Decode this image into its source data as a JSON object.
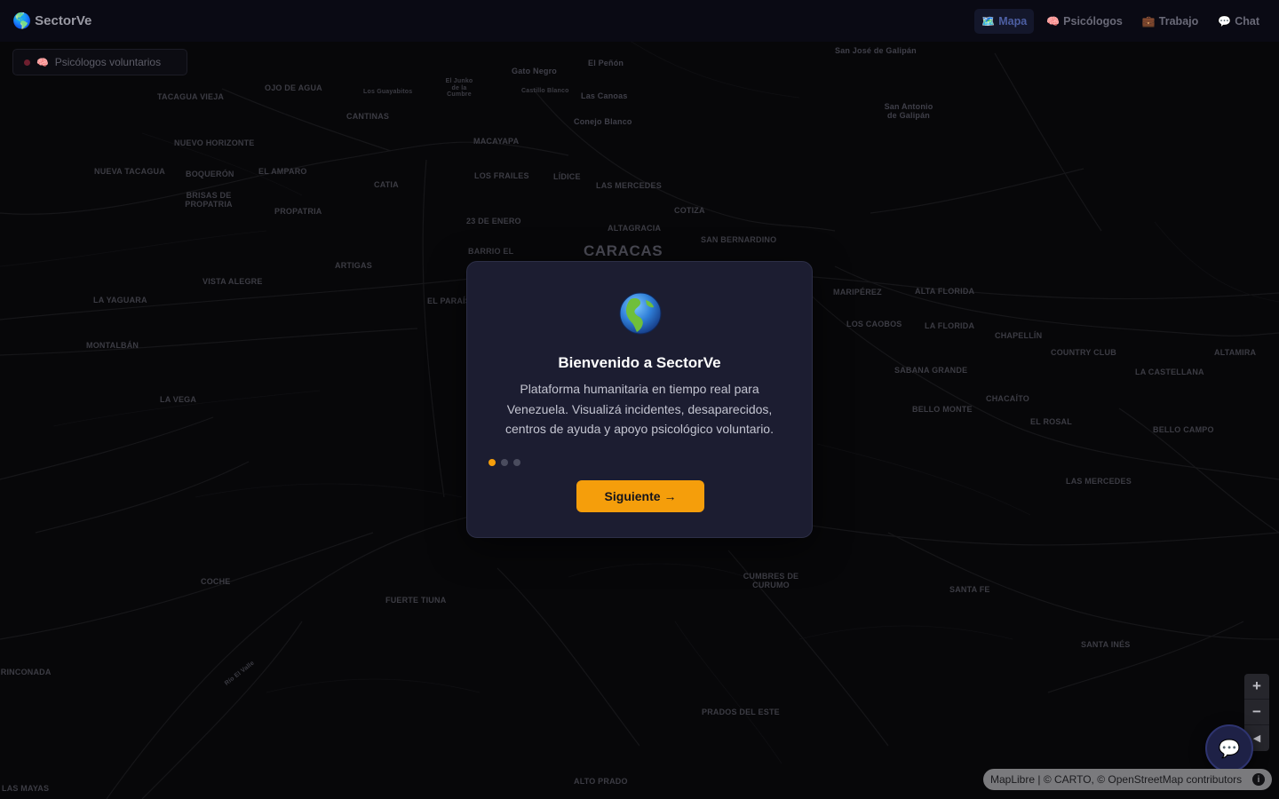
{
  "app": {
    "name": "SectorVe",
    "logo_icon": "🌎"
  },
  "nav": {
    "items": [
      {
        "icon": "🗺️",
        "icon_name": "map-icon",
        "label": "Mapa",
        "active": true
      },
      {
        "icon": "🧠",
        "icon_name": "brain-icon",
        "label": "Psicólogos",
        "active": false
      },
      {
        "icon": "💼",
        "icon_name": "briefcase-icon",
        "label": "Trabajo",
        "active": false
      },
      {
        "icon": "💬",
        "icon_name": "chat-icon",
        "label": "Chat",
        "active": false
      }
    ]
  },
  "legend": {
    "icon": "🧠",
    "label": "Psicólogos voluntarios",
    "dot_color": "#6e1f2f"
  },
  "modal": {
    "icon": "🌎",
    "title": "Bienvenido a SectorVe",
    "description": "Plataforma humanitaria en tiempo real para Venezuela. Visualizá incidentes, desaparecidos, centros de ayuda y apoyo psicológico voluntario.",
    "steps_total": 3,
    "step_current": 1,
    "next_label": "Siguiente →",
    "accent_color": "#f59e0b"
  },
  "map": {
    "city_label": "CARACAS",
    "places": [
      {
        "name": "San José de Galipán",
        "style": "mixed"
      },
      {
        "name": "El Peñón",
        "style": "mixed"
      },
      {
        "name": "Gato Negro",
        "style": "mixed"
      },
      {
        "name": "El Junko de la Cumbre",
        "style": "small"
      },
      {
        "name": "Castillo Blanco",
        "style": "small"
      },
      {
        "name": "Las Canoas",
        "style": "mixed"
      },
      {
        "name": "Conejo Blanco",
        "style": "mixed"
      },
      {
        "name": "San Antonio de Galipán",
        "style": "mixed"
      },
      {
        "name": "OJO DE AGUA",
        "style": "upper"
      },
      {
        "name": "Los Guayabitos",
        "style": "small"
      },
      {
        "name": "TACAGUA VIEJA",
        "style": "upper"
      },
      {
        "name": "CANTINAS",
        "style": "upper"
      },
      {
        "name": "NUEVO HORIZONTE",
        "style": "upper"
      },
      {
        "name": "MACAYAPA",
        "style": "upper"
      },
      {
        "name": "NUEVA TACAGUA",
        "style": "upper"
      },
      {
        "name": "BOQUERÓN",
        "style": "upper"
      },
      {
        "name": "EL AMPARO",
        "style": "upper"
      },
      {
        "name": "LOS FRAILES",
        "style": "upper"
      },
      {
        "name": "LÍDICE",
        "style": "upper"
      },
      {
        "name": "LAS MERCEDES",
        "style": "upper"
      },
      {
        "name": "BRISAS DE PROPATRIA",
        "style": "upper"
      },
      {
        "name": "CATIA",
        "style": "upper"
      },
      {
        "name": "PROPATRIA",
        "style": "upper"
      },
      {
        "name": "23 DE ENERO",
        "style": "upper"
      },
      {
        "name": "COTIZA",
        "style": "upper"
      },
      {
        "name": "ALTAGRACIA",
        "style": "upper"
      },
      {
        "name": "SAN BERNARDINO",
        "style": "upper"
      },
      {
        "name": "BARRIO EL",
        "style": "upper"
      },
      {
        "name": "ARTIGAS",
        "style": "upper"
      },
      {
        "name": "LA YAGUARA",
        "style": "upper"
      },
      {
        "name": "VISTA ALEGRE",
        "style": "upper"
      },
      {
        "name": "EL PARAÍSO",
        "style": "upper"
      },
      {
        "name": "MARIPÉREZ",
        "style": "upper"
      },
      {
        "name": "ALTA FLORIDA",
        "style": "upper"
      },
      {
        "name": "LOS CAOBOS",
        "style": "upper"
      },
      {
        "name": "LA FLORIDA",
        "style": "upper"
      },
      {
        "name": "CHAPELLÍN",
        "style": "upper"
      },
      {
        "name": "MONTALBÁN",
        "style": "upper"
      },
      {
        "name": "COUNTRY CLUB",
        "style": "upper"
      },
      {
        "name": "ALTAMIRA",
        "style": "upper"
      },
      {
        "name": "SABANA GRANDE",
        "style": "upper"
      },
      {
        "name": "LA CASTELLANA",
        "style": "upper"
      },
      {
        "name": "LA VEGA",
        "style": "upper"
      },
      {
        "name": "CHACAÍTO",
        "style": "upper"
      },
      {
        "name": "BELLO MONTE",
        "style": "upper"
      },
      {
        "name": "EL ROSAL",
        "style": "upper"
      },
      {
        "name": "BELLO CAMPO",
        "style": "upper"
      },
      {
        "name": "LAS MERCEDES",
        "style": "upper"
      },
      {
        "name": "COCHE",
        "style": "upper"
      },
      {
        "name": "FUERTE TIUNA",
        "style": "upper"
      },
      {
        "name": "CUMBRES DE CURUMO",
        "style": "upper"
      },
      {
        "name": "SANTA FE",
        "style": "upper"
      },
      {
        "name": "SANTA INÉS",
        "style": "upper"
      },
      {
        "name": "PRADOS DEL ESTE",
        "style": "upper"
      },
      {
        "name": "ALTO PRADO",
        "style": "upper"
      },
      {
        "name": "LAS MAYAS",
        "style": "upper"
      },
      {
        "name": "LA RINCONADA",
        "style": "upper"
      },
      {
        "name": "Río El Valle",
        "style": "small"
      }
    ],
    "zoom_in": "+",
    "zoom_out": "−",
    "compass": "◀",
    "attribution": "MapLibre | © CARTO, © OpenStreetMap contributors",
    "attribution_info": "i"
  },
  "chat_fab": {
    "icon": "💬"
  }
}
